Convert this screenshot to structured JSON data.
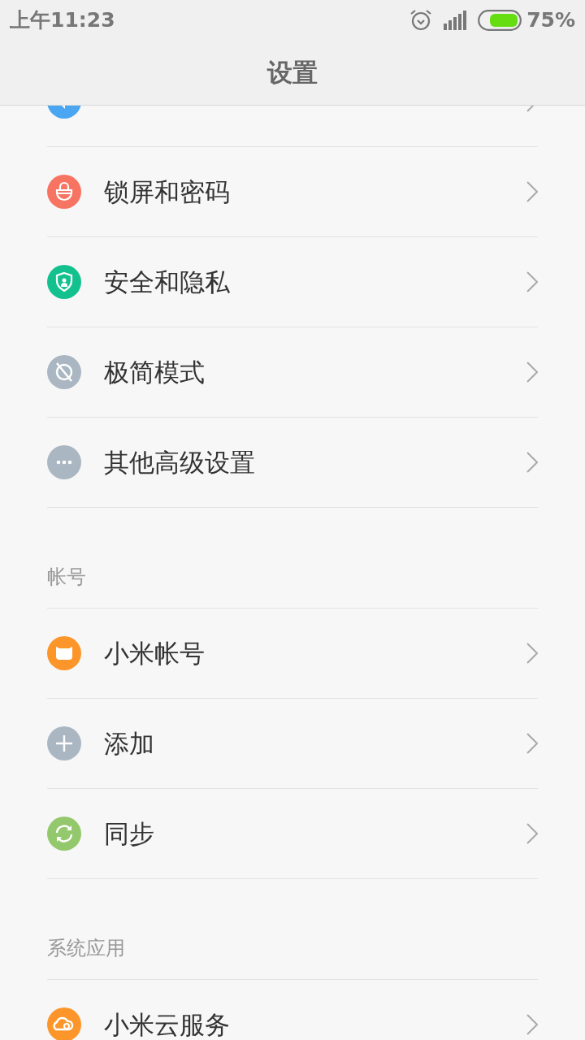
{
  "status_bar": {
    "time": "上午11:23",
    "battery": "75%"
  },
  "header": {
    "title": "设置"
  },
  "sections": [
    {
      "items": [
        {
          "kind": "sound",
          "color": "#4aa6f2"
        },
        {
          "label": "锁屏和密码",
          "kind": "lock",
          "color": "#f87462"
        },
        {
          "label": "安全和隐私",
          "kind": "shield",
          "color": "#13c18e"
        },
        {
          "label": "极简模式",
          "kind": "simple",
          "color": "#aab7c2"
        },
        {
          "label": "其他高级设置",
          "kind": "more",
          "color": "#aab7c2"
        }
      ]
    },
    {
      "title": "帐号",
      "items": [
        {
          "label": "小米帐号",
          "kind": "mi",
          "color": "#fd962a"
        },
        {
          "label": "添加",
          "kind": "add",
          "color": "#aab7c2"
        },
        {
          "label": "同步",
          "kind": "sync",
          "color": "#94c86c"
        }
      ]
    },
    {
      "title": "系统应用",
      "items": [
        {
          "label": "小米云服务",
          "kind": "cloud",
          "color": "#fd962a"
        }
      ]
    }
  ]
}
